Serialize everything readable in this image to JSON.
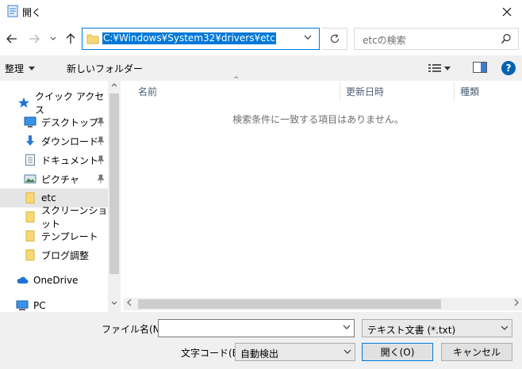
{
  "window": {
    "title": "開く"
  },
  "nav": {
    "address": "C:¥Windows¥System32¥drivers¥etc",
    "search_placeholder": "etcの検索"
  },
  "toolbar": {
    "organize_label": "整理",
    "new_folder_label": "新しいフォルダー"
  },
  "sidebar": {
    "quick_access": "クイック アクセス",
    "items": [
      {
        "label": "デスクトップ",
        "icon": "desktop-icon",
        "pinned": true
      },
      {
        "label": "ダウンロード",
        "icon": "download-icon",
        "pinned": true
      },
      {
        "label": "ドキュメント",
        "icon": "document-icon",
        "pinned": true
      },
      {
        "label": "ピクチャ",
        "icon": "picture-icon",
        "pinned": true
      },
      {
        "label": "etc",
        "icon": "folder-icon",
        "pinned": false,
        "selected": true
      },
      {
        "label": "スクリーンショット",
        "icon": "folder-icon",
        "pinned": false
      },
      {
        "label": "テンプレート",
        "icon": "folder-icon",
        "pinned": false
      },
      {
        "label": "ブログ調整",
        "icon": "folder-icon",
        "pinned": false
      }
    ],
    "onedrive": "OneDrive",
    "pc": "PC"
  },
  "file_list": {
    "columns": [
      "名前",
      "更新日時",
      "種類"
    ],
    "empty_message": "検索条件に一致する項目はありません。"
  },
  "bottom": {
    "filename_label": "ファイル名(N):",
    "filename_value": "",
    "filetype_value": "テキスト文書 (*.txt)",
    "encoding_label": "文字コード(E):",
    "encoding_value": "自動検出",
    "open_label": "開く(O)",
    "cancel_label": "キャンセル"
  },
  "colors": {
    "accent": "#0078d7",
    "folder": "#f8d775",
    "help": "#0063b1"
  }
}
